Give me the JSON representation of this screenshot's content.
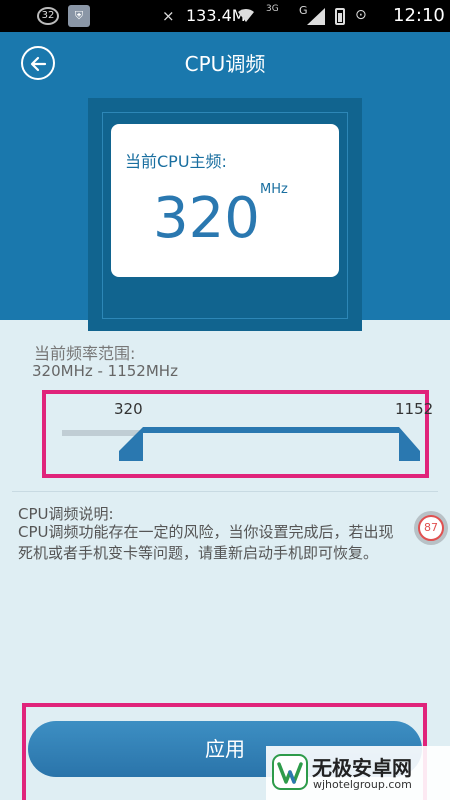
{
  "status_bar": {
    "notification_count": "32",
    "speed": "133.4M",
    "network_type": "3G",
    "signal_label": "G",
    "time": "12:10",
    "icons": [
      "notification-badge-icon",
      "shield-icon",
      "mute-icon",
      "wifi-icon",
      "signal-icon",
      "battery-icon",
      "alarm-icon"
    ]
  },
  "header": {
    "title": "CPU调频"
  },
  "current_freq": {
    "label": "当前CPU主频:",
    "value": "320",
    "unit": "MHz"
  },
  "range": {
    "label": "当前频率范围:",
    "value": "320MHz - 1152MHz",
    "slider_min": "320",
    "slider_max": "1152"
  },
  "description": {
    "title": "CPU调频说明:",
    "body": "CPU调频功能存在一定的风险，当你设置完成后，若出现死机或者手机变卡等问题，请重新启动手机即可恢复。"
  },
  "badge": {
    "value": "87"
  },
  "apply": {
    "label": "应用"
  },
  "watermark": {
    "name": "无极安卓网",
    "url": "wjhotelgroup.com"
  },
  "colors": {
    "header_bg": "#1a78ad",
    "accent": "#2a78b0",
    "highlight": "#e0237a"
  }
}
